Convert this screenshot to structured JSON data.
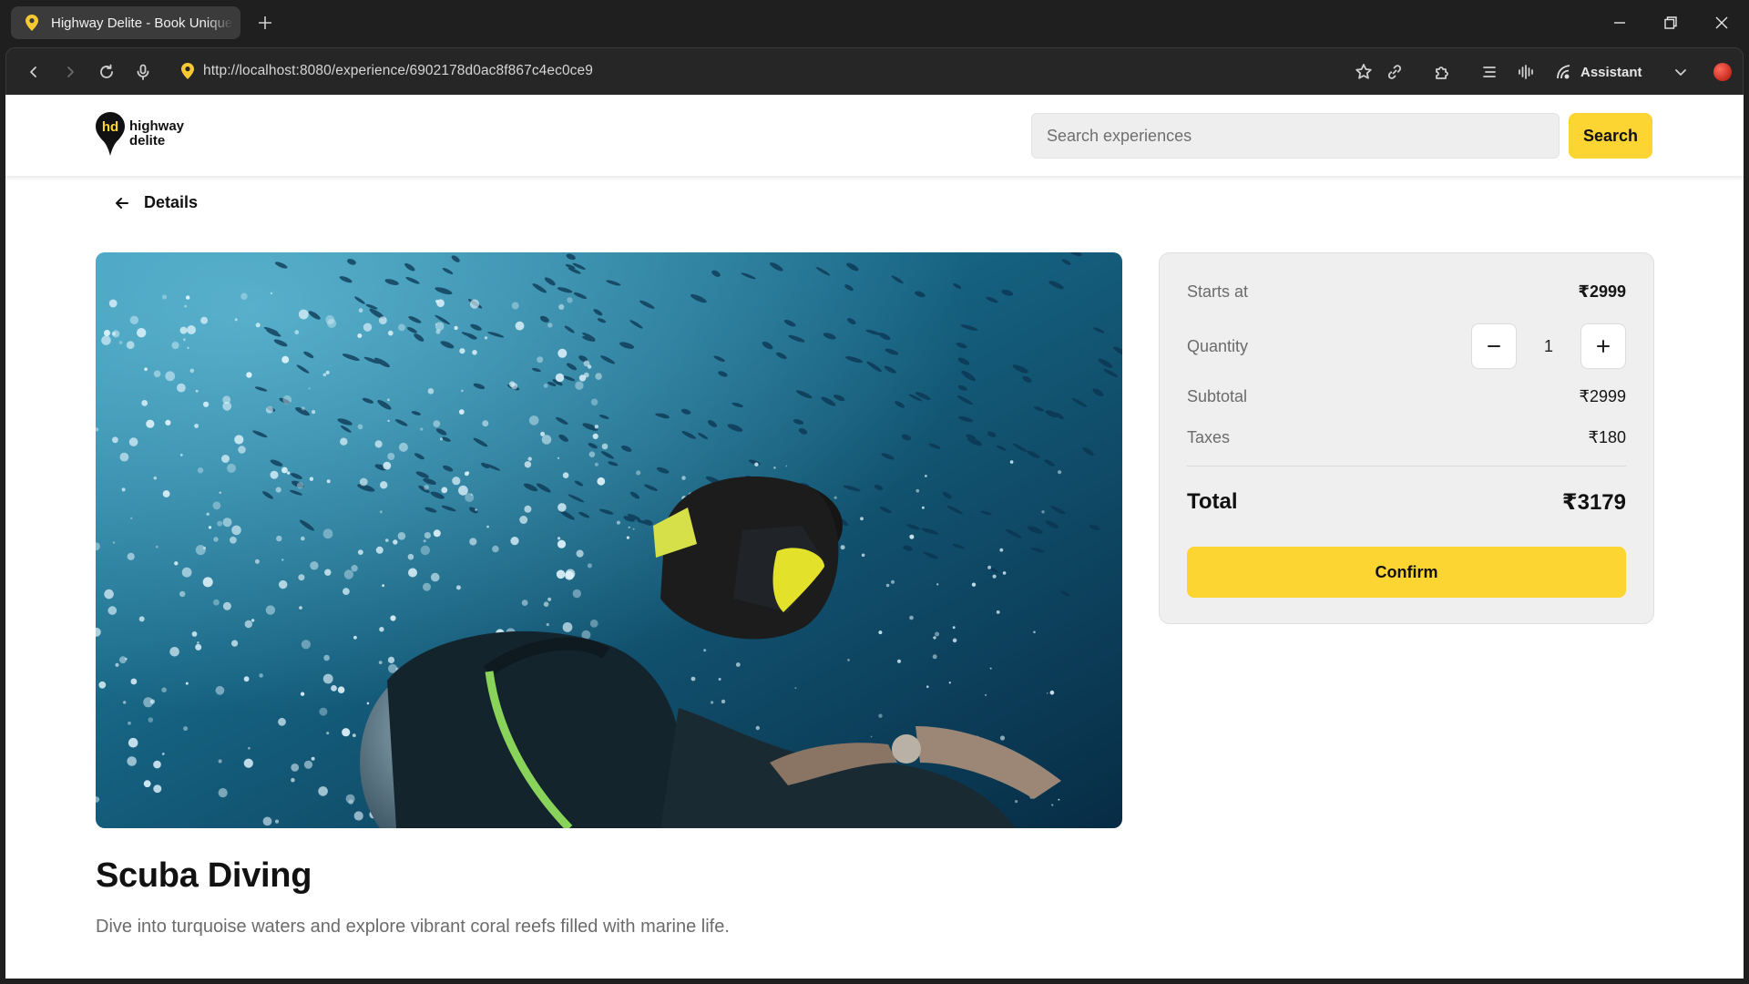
{
  "browser": {
    "tab_title": "Highway Delite - Book Unique Experiences",
    "url": "http://localhost:8080/experience/6902178d0ac8f867c4ec0ce9",
    "assistant_label": "Assistant"
  },
  "header": {
    "logo_initials": "hd",
    "logo_line1": "highway",
    "logo_line2": "delite",
    "search_placeholder": "Search experiences",
    "search_button": "Search"
  },
  "page": {
    "back_label": "Details",
    "title": "Scuba Diving",
    "description": "Dive into turquoise waters and explore vibrant coral reefs filled with marine life."
  },
  "booking": {
    "starts_at_label": "Starts at",
    "starts_at_value": "₹2999",
    "quantity_label": "Quantity",
    "quantity_value": "1",
    "subtotal_label": "Subtotal",
    "subtotal_value": "₹2999",
    "taxes_label": "Taxes",
    "taxes_value": "₹180",
    "total_label": "Total",
    "total_value": "₹3179",
    "confirm_label": "Confirm"
  },
  "colors": {
    "accent": "#fdd532",
    "card_bg": "#efefef",
    "chrome_bg": "#1f1f1f"
  },
  "icons": [
    "location-pin-icon",
    "plus-icon",
    "minimize-icon",
    "restore-icon",
    "close-icon",
    "back-icon",
    "forward-icon",
    "reload-icon",
    "microphone-icon",
    "star-icon",
    "link-icon",
    "extensions-icon",
    "reader-icon",
    "voice-icon",
    "assistant-icon",
    "chevron-down-icon",
    "arrow-left-icon",
    "minus-icon"
  ]
}
